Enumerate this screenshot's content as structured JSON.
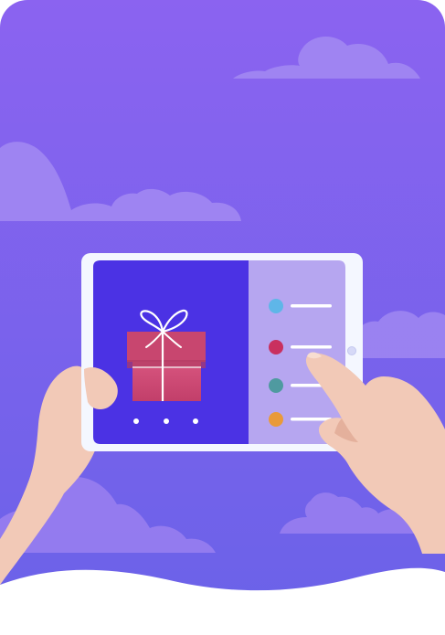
{
  "illustration": {
    "subject": "hands-holding-tablet-gift-selection",
    "colors": {
      "sky_top": "#8b63f0",
      "sky_bottom": "#6a62e8",
      "cloud": "#a389f2",
      "tablet_frame": "#f4f7ff",
      "screen_left": "#4b32e4",
      "screen_right": "#b6a6f0",
      "gift_box": "#d2507a",
      "gift_lid": "#c4426d",
      "ribbon": "#ffffff",
      "skin": "#f2c9b7",
      "skin_shadow": "#e4b09c",
      "wave": "#ffffff"
    },
    "options": [
      {
        "color": "#5fb6e8"
      },
      {
        "color": "#c9305f"
      },
      {
        "color": "#4f9aa0"
      },
      {
        "color": "#e99a3a"
      }
    ],
    "carousel_dots": 3
  }
}
